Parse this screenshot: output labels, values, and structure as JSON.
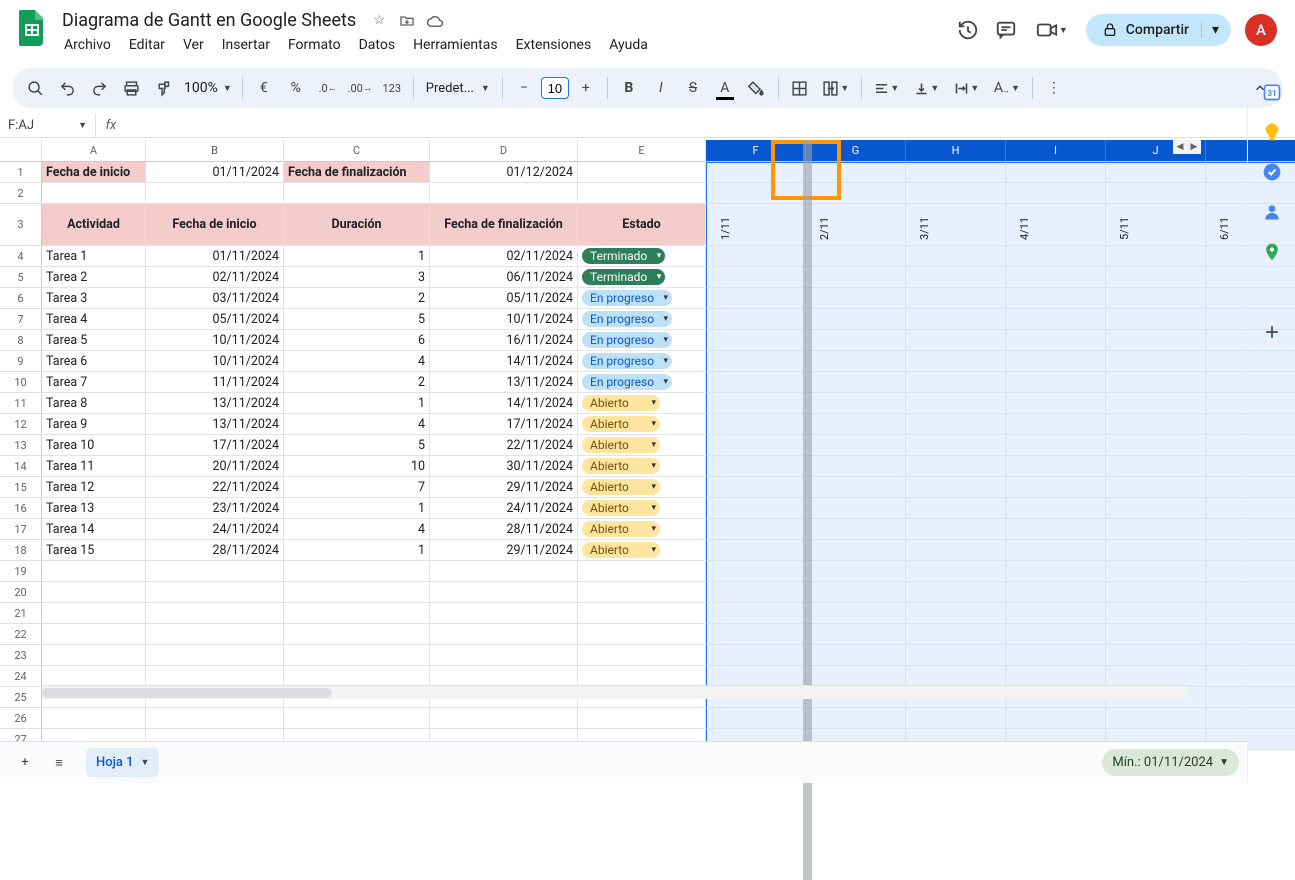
{
  "doc": {
    "title": "Diagrama de Gantt en Google Sheets"
  },
  "menu": [
    "Archivo",
    "Editar",
    "Ver",
    "Insertar",
    "Formato",
    "Datos",
    "Herramientas",
    "Extensiones",
    "Ayuda"
  ],
  "share": {
    "label": "Compartir"
  },
  "avatar": {
    "letter": "A"
  },
  "toolbar": {
    "zoom": "100%",
    "font": "Predet...",
    "fontsize": "10"
  },
  "namebox": "F:AJ",
  "columns": [
    "A",
    "B",
    "C",
    "D",
    "E",
    "F",
    "G",
    "H",
    "I",
    "J"
  ],
  "selected_cols_start": 5,
  "row1": {
    "a": "Fecha de inicio",
    "b": "01/11/2024",
    "c": "Fecha de finalización",
    "d": "01/12/2024"
  },
  "headers": {
    "a": "Actividad",
    "b": "Fecha de inicio",
    "c": "Duración",
    "d": "Fecha de finalización",
    "e": "Estado"
  },
  "dates": [
    "1/11",
    "2/11",
    "3/11",
    "4/11",
    "5/11",
    "6/11"
  ],
  "tasks": [
    {
      "n": "Tarea 1",
      "s": "01/11/2024",
      "d": "1",
      "e": "02/11/2024",
      "st": "Terminado",
      "cls": "term"
    },
    {
      "n": "Tarea 2",
      "s": "02/11/2024",
      "d": "3",
      "e": "06/11/2024",
      "st": "Terminado",
      "cls": "term"
    },
    {
      "n": "Tarea 3",
      "s": "03/11/2024",
      "d": "2",
      "e": "05/11/2024",
      "st": "En progreso",
      "cls": "prog"
    },
    {
      "n": "Tarea 4",
      "s": "05/11/2024",
      "d": "5",
      "e": "10/11/2024",
      "st": "En progreso",
      "cls": "prog"
    },
    {
      "n": "Tarea 5",
      "s": "10/11/2024",
      "d": "6",
      "e": "16/11/2024",
      "st": "En progreso",
      "cls": "prog"
    },
    {
      "n": "Tarea 6",
      "s": "10/11/2024",
      "d": "4",
      "e": "14/11/2024",
      "st": "En progreso",
      "cls": "prog"
    },
    {
      "n": "Tarea 7",
      "s": "11/11/2024",
      "d": "2",
      "e": "13/11/2024",
      "st": "En progreso",
      "cls": "prog"
    },
    {
      "n": "Tarea 8",
      "s": "13/11/2024",
      "d": "1",
      "e": "14/11/2024",
      "st": "Abierto",
      "cls": "open"
    },
    {
      "n": "Tarea 9",
      "s": "13/11/2024",
      "d": "4",
      "e": "17/11/2024",
      "st": "Abierto",
      "cls": "open"
    },
    {
      "n": "Tarea 10",
      "s": "17/11/2024",
      "d": "5",
      "e": "22/11/2024",
      "st": "Abierto",
      "cls": "open"
    },
    {
      "n": "Tarea 11",
      "s": "20/11/2024",
      "d": "10",
      "e": "30/11/2024",
      "st": "Abierto",
      "cls": "open"
    },
    {
      "n": "Tarea 12",
      "s": "22/11/2024",
      "d": "7",
      "e": "29/11/2024",
      "st": "Abierto",
      "cls": "open"
    },
    {
      "n": "Tarea 13",
      "s": "23/11/2024",
      "d": "1",
      "e": "24/11/2024",
      "st": "Abierto",
      "cls": "open"
    },
    {
      "n": "Tarea 14",
      "s": "24/11/2024",
      "d": "4",
      "e": "28/11/2024",
      "st": "Abierto",
      "cls": "open"
    },
    {
      "n": "Tarea 15",
      "s": "28/11/2024",
      "d": "1",
      "e": "29/11/2024",
      "st": "Abierto",
      "cls": "open"
    }
  ],
  "empty_rows": [
    19,
    20,
    21,
    22,
    23,
    24,
    25,
    26,
    27
  ],
  "sheet_tab": "Hoja 1",
  "aggregate": "Mín.: 01/11/2024"
}
